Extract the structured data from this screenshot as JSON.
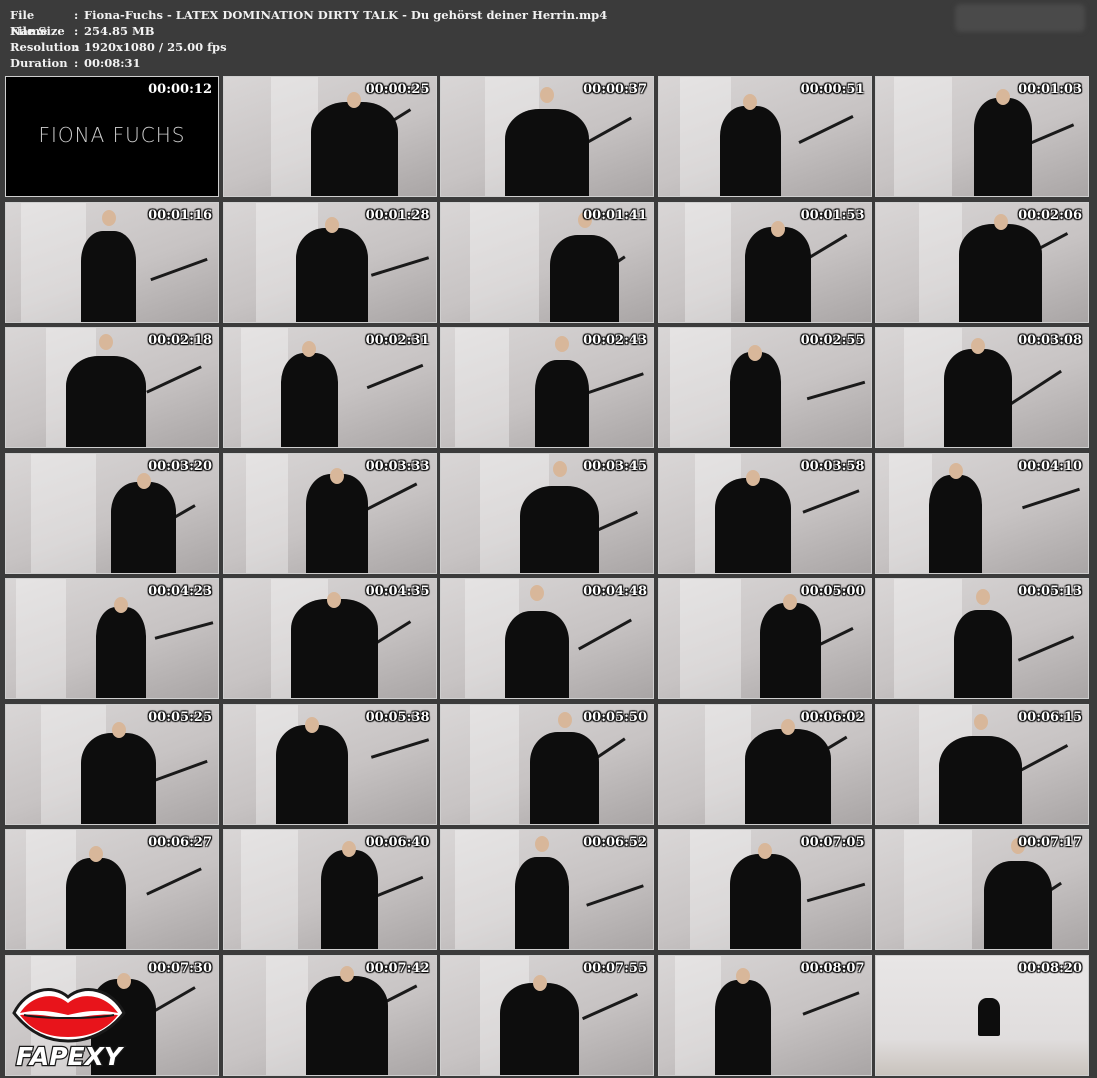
{
  "header": {
    "file_name_label": "File Name",
    "file_name": "Fiona-Fuchs - LATEX DOMINATION DIRTY TALK - Du gehörst deiner Herrin.mp4",
    "file_size_label": "File Size",
    "file_size": "254.85 MB",
    "resolution_label": "Resolution",
    "resolution": "1920x1080 / 25.00 fps",
    "duration_label": "Duration",
    "duration": "00:08:31",
    "separator": ":"
  },
  "title_card": {
    "brand": "FIONA FUCHS"
  },
  "thumbnails": [
    {
      "timestamp": "00:00:12"
    },
    {
      "timestamp": "00:00:25"
    },
    {
      "timestamp": "00:00:37"
    },
    {
      "timestamp": "00:00:51"
    },
    {
      "timestamp": "00:01:03"
    },
    {
      "timestamp": "00:01:16"
    },
    {
      "timestamp": "00:01:28"
    },
    {
      "timestamp": "00:01:41"
    },
    {
      "timestamp": "00:01:53"
    },
    {
      "timestamp": "00:02:06"
    },
    {
      "timestamp": "00:02:18"
    },
    {
      "timestamp": "00:02:31"
    },
    {
      "timestamp": "00:02:43"
    },
    {
      "timestamp": "00:02:55"
    },
    {
      "timestamp": "00:03:08"
    },
    {
      "timestamp": "00:03:20"
    },
    {
      "timestamp": "00:03:33"
    },
    {
      "timestamp": "00:03:45"
    },
    {
      "timestamp": "00:03:58"
    },
    {
      "timestamp": "00:04:10"
    },
    {
      "timestamp": "00:04:23"
    },
    {
      "timestamp": "00:04:35"
    },
    {
      "timestamp": "00:04:48"
    },
    {
      "timestamp": "00:05:00"
    },
    {
      "timestamp": "00:05:13"
    },
    {
      "timestamp": "00:05:25"
    },
    {
      "timestamp": "00:05:38"
    },
    {
      "timestamp": "00:05:50"
    },
    {
      "timestamp": "00:06:02"
    },
    {
      "timestamp": "00:06:15"
    },
    {
      "timestamp": "00:06:27"
    },
    {
      "timestamp": "00:06:40"
    },
    {
      "timestamp": "00:06:52"
    },
    {
      "timestamp": "00:07:05"
    },
    {
      "timestamp": "00:07:17"
    },
    {
      "timestamp": "00:07:30"
    },
    {
      "timestamp": "00:07:42"
    },
    {
      "timestamp": "00:07:55"
    },
    {
      "timestamp": "00:08:07"
    },
    {
      "timestamp": "00:08:20"
    }
  ],
  "logo": {
    "text": "FAPEXY",
    "lip_color": "#e8141b",
    "outline_color": "#1a1a1a"
  }
}
